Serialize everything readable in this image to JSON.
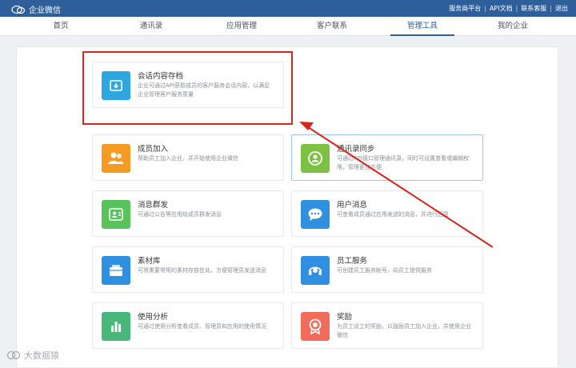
{
  "header": {
    "brand": "企业微信",
    "links": [
      "服务商平台",
      "API文档",
      "联系客服",
      "退出"
    ]
  },
  "nav": {
    "tabs": [
      {
        "label": "首页"
      },
      {
        "label": "通讯录"
      },
      {
        "label": "应用管理"
      },
      {
        "label": "客户联系"
      },
      {
        "label": "管理工具",
        "active": true
      },
      {
        "label": "我的企业"
      }
    ]
  },
  "cards": {
    "archive": {
      "title": "会话内容存档",
      "desc": "企业可通过API获取成员的客户服务会话内容，以满足企业管理客户服务质量",
      "icon": "archive-icon",
      "color": "#2ea7e0"
    },
    "member_join": {
      "title": "成员加入",
      "desc": "帮助员工加入企业，并开始使用企业微信",
      "icon": "members-icon",
      "color": "#f59a23"
    },
    "contact_sync": {
      "title": "通讯录同步",
      "desc": "可通过API接口管理通讯录，同时可设置查看或编辑权限，管理更加方便",
      "icon": "sync-icon",
      "color": "#7cc142"
    },
    "broadcast": {
      "title": "消息群发",
      "desc": "可通过公告等应用给成员群发消息",
      "icon": "broadcast-icon",
      "color": "#58c35a"
    },
    "user_msg": {
      "title": "用户消息",
      "desc": "可查看成员通过应用发送的消息，并进行回复",
      "icon": "chat-icon",
      "color": "#2f8fe0"
    },
    "materials": {
      "title": "素材库",
      "desc": "可将重要常用的素材存放在此，方便管理员发送消息",
      "icon": "folder-icon",
      "color": "#2f8fe0"
    },
    "staff_service": {
      "title": "员工服务",
      "desc": "可创建员工服务帐号，向员工提供服务",
      "icon": "headset-icon",
      "color": "#2f8fe0"
    },
    "analytics": {
      "title": "使用分析",
      "desc": "可通过使用分析查看成员、管理员和应用的使用情况",
      "icon": "bar-chart-icon",
      "color": "#47b87a"
    },
    "reward": {
      "title": "奖励",
      "desc": "为员工设立的奖励，以鼓励员工加入企业，并使用企业微信",
      "icon": "medal-icon",
      "color": "#f26b5b"
    }
  },
  "watermark": "大数据猿"
}
